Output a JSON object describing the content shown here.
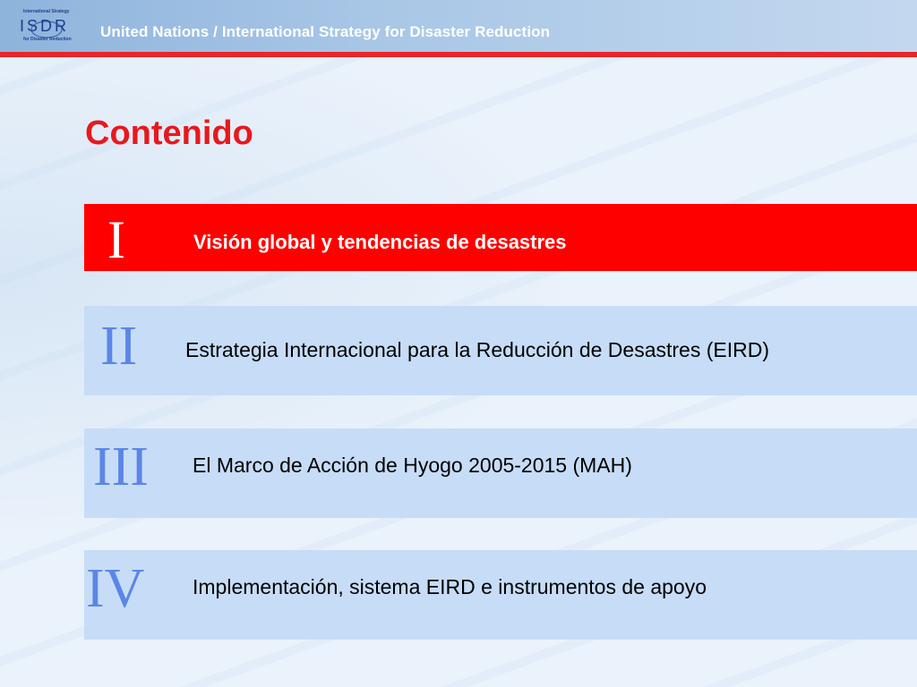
{
  "header": {
    "logo_top": "International Strategy",
    "logo_letters": "ISDR",
    "logo_bottom": "for Disaster Reduction",
    "title": "United Nations / International Strategy for Disaster Reduction"
  },
  "page": {
    "title": "Contenido"
  },
  "items": [
    {
      "numeral": "I",
      "text": "Visión global y tendencias de desastres",
      "active": true
    },
    {
      "numeral": "II",
      "text": "Estrategia Internacional para la Reducción de Desastres (EIRD)",
      "active": false
    },
    {
      "numeral": "III",
      "text": "El Marco de Acción de Hyogo 2005-2015 (MAH)",
      "active": false
    },
    {
      "numeral": "IV",
      "text": "Implementación, sistema EIRD e instrumentos de apoyo",
      "active": false
    }
  ],
  "colors": {
    "accent_red": "#ff0000",
    "item_bg": "#c7dcf6",
    "numeral_blue": "#5b86e6",
    "header_blue": "#8eb4dc"
  }
}
